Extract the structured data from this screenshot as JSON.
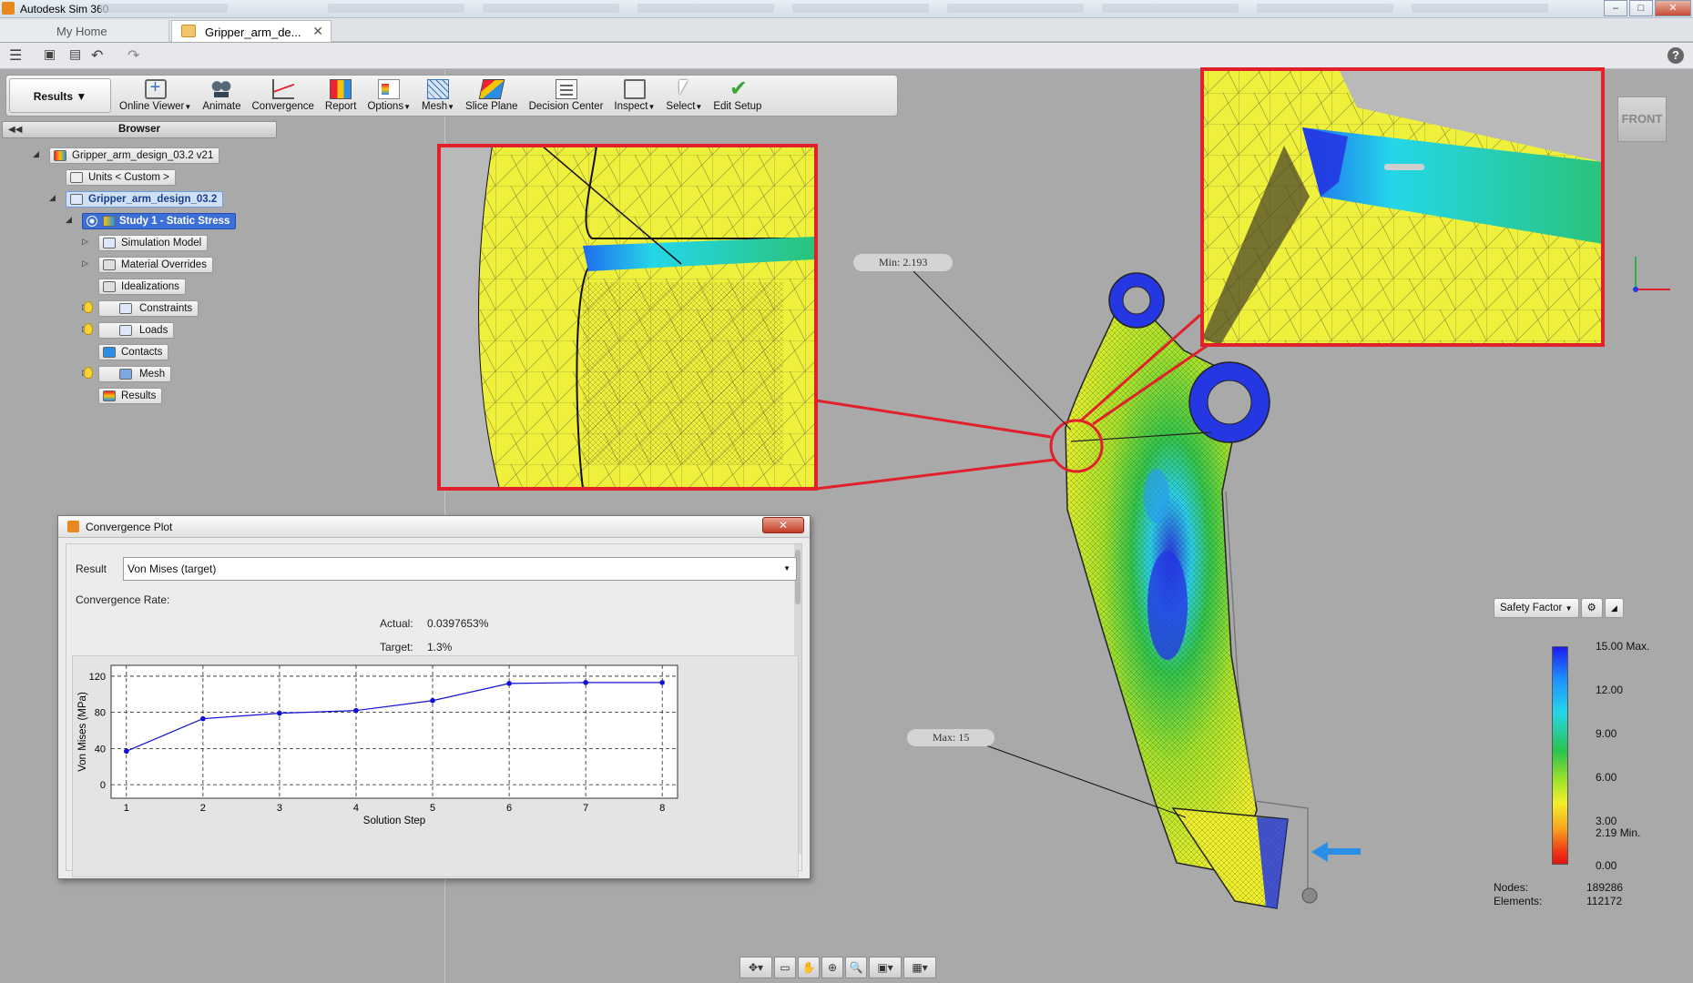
{
  "window": {
    "app_title": "Autodesk Sim 360",
    "controls": [
      "–",
      "□",
      "✕"
    ]
  },
  "tabs": {
    "home": "My Home",
    "active": "Gripper_arm_de...",
    "close": "✕"
  },
  "ribbon": {
    "workspace": "Results",
    "buttons": [
      {
        "label": "Online Viewer",
        "icon": "online-viewer-icon",
        "dropdown": true
      },
      {
        "label": "Animate",
        "icon": "animate-icon",
        "dropdown": false
      },
      {
        "label": "Convergence",
        "icon": "convergence-icon",
        "dropdown": false
      },
      {
        "label": "Report",
        "icon": "report-icon",
        "dropdown": false
      },
      {
        "label": "Options",
        "icon": "options-icon",
        "dropdown": true
      },
      {
        "label": "Mesh",
        "icon": "mesh-icon",
        "dropdown": true
      },
      {
        "label": "Slice Plane",
        "icon": "slice-plane-icon",
        "dropdown": false
      },
      {
        "label": "Decision Center",
        "icon": "decision-center-icon",
        "dropdown": false
      },
      {
        "label": "Inspect",
        "icon": "inspect-icon",
        "dropdown": true
      },
      {
        "label": "Select",
        "icon": "select-icon",
        "dropdown": true
      },
      {
        "label": "Edit Setup",
        "icon": "edit-setup-icon",
        "dropdown": false
      }
    ]
  },
  "browser": {
    "title": "Browser",
    "root": "Gripper_arm_design_03.2 v21",
    "units": "Units < Custom >",
    "design": "Gripper_arm_design_03.2",
    "study": "Study 1 - Static Stress",
    "items": [
      {
        "label": "Simulation Model"
      },
      {
        "label": "Material Overrides"
      },
      {
        "label": "Idealizations"
      },
      {
        "label": "Constraints"
      },
      {
        "label": "Loads"
      },
      {
        "label": "Contacts"
      },
      {
        "label": "Mesh"
      },
      {
        "label": "Results"
      }
    ]
  },
  "dialog": {
    "title": "Convergence Plot",
    "close": "✕",
    "result_label": "Result",
    "result_value": "Von Mises (target)",
    "rate_label": "Convergence Rate:",
    "actual_label": "Actual:",
    "actual_value": "0.0397653%",
    "target_label": "Target:",
    "target_value": "1.3%"
  },
  "chart_data": {
    "type": "line",
    "x": [
      1,
      2,
      3,
      4,
      5,
      6,
      7,
      8
    ],
    "series": [
      {
        "values": [
          37,
          73,
          79,
          82,
          93,
          112,
          113,
          113
        ]
      }
    ],
    "xlabel": "Solution Step",
    "ylabel": "Von Mises (MPa)",
    "yticks": [
      0,
      40,
      80,
      120
    ],
    "xlim": [
      0.8,
      8.2
    ],
    "ylim": [
      -15,
      132
    ],
    "grid": true,
    "color": "#1010d8"
  },
  "viewport": {
    "min_callout": "Min: 2.193",
    "max_callout": "Max: 15",
    "view_cube": "FRONT",
    "highlight_color": "#e0202a"
  },
  "legend": {
    "type_label": "Safety Factor",
    "labels": [
      "15.00 Max.",
      "12.00",
      "9.00",
      "6.00",
      "3.00",
      "2.19 Min.",
      "0.00"
    ],
    "nodes_label": "Nodes:",
    "nodes_value": "189286",
    "elements_label": "Elements:",
    "elements_value": "112172"
  }
}
